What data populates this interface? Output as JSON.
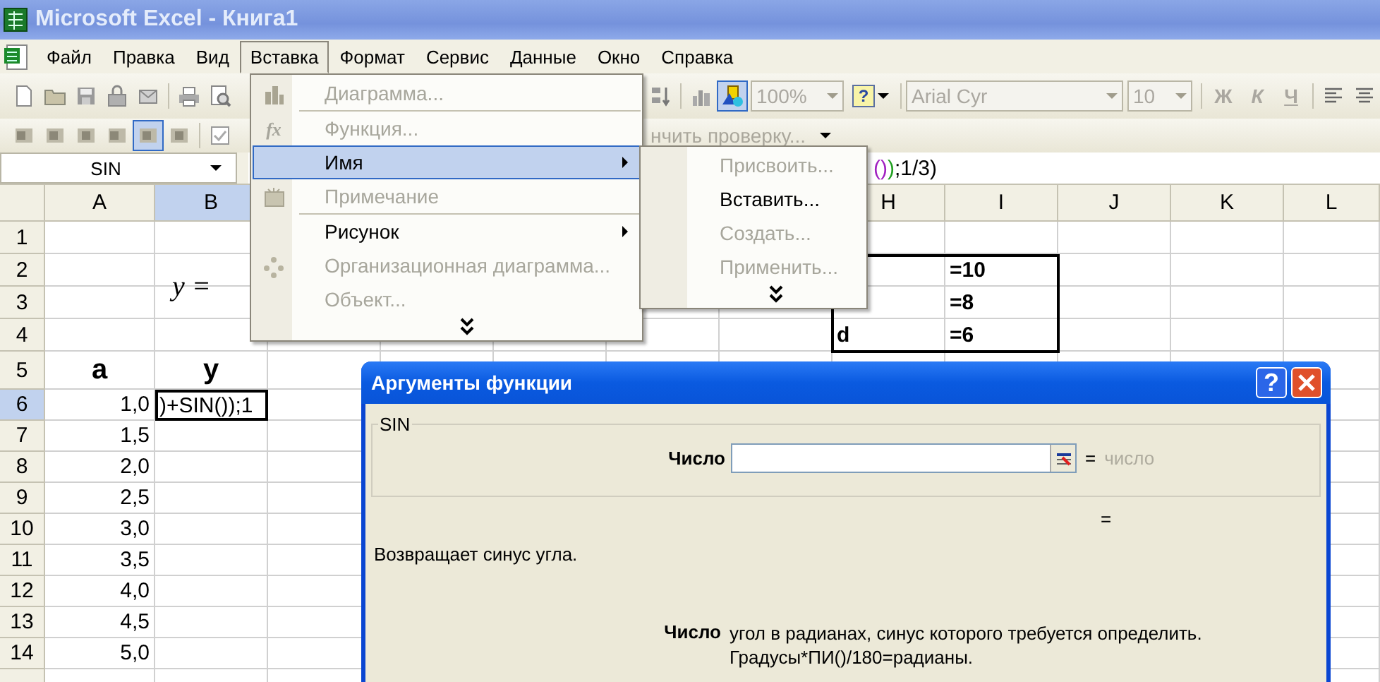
{
  "window": {
    "title": "Microsoft Excel - Книга1"
  },
  "menu_bar": [
    {
      "label": "Файл",
      "selected": false
    },
    {
      "label": "Правка",
      "selected": false
    },
    {
      "label": "Вид",
      "selected": false
    },
    {
      "label": "Вставка",
      "selected": true
    },
    {
      "label": "Формат",
      "selected": false
    },
    {
      "label": "Сервис",
      "selected": false
    },
    {
      "label": "Данные",
      "selected": false
    },
    {
      "label": "Окно",
      "selected": false
    },
    {
      "label": "Справка",
      "selected": false
    }
  ],
  "standard_toolbar": {
    "left_buttons": [
      {
        "pressed": false
      },
      {
        "pressed": false
      },
      {
        "pressed": false
      },
      {
        "pressed": false
      },
      {
        "pressed": false
      },
      {
        "pressed": false
      },
      {
        "pressed": false
      }
    ],
    "right_buttons": [
      {
        "pressed": false
      },
      {
        "pressed": false
      },
      {
        "pressed": true
      }
    ],
    "zoom": "100%",
    "help": "?",
    "font": "Arial Cyr",
    "font_size": "10",
    "format_buttons": [
      "Ж",
      "К",
      "Ч"
    ]
  },
  "review_toolbar": {
    "buttons": [
      {
        "pressed": false
      },
      {
        "pressed": false
      },
      {
        "pressed": false
      },
      {
        "pressed": false
      },
      {
        "pressed": true
      },
      {
        "pressed": false
      },
      {
        "pressed": false
      }
    ],
    "action": "нчить проверку..."
  },
  "formula_bar": {
    "name_box": "SIN",
    "formula": [
      {
        "text": "()",
        "color": "#a020c0"
      },
      {
        "text": ")",
        "color": "#20a020"
      },
      {
        "text": ";1/3)",
        "color": "#000000"
      }
    ]
  },
  "sheet": {
    "columns": [
      {
        "label": "A",
        "selected": false
      },
      {
        "label": "B",
        "selected": true
      },
      {
        "label": "H",
        "selected": false
      },
      {
        "label": "I",
        "selected": false
      },
      {
        "label": "J",
        "selected": false
      },
      {
        "label": "K",
        "selected": false
      },
      {
        "label": "L",
        "selected": false
      }
    ],
    "equation": "y =",
    "rows": [
      {
        "number": "1",
        "selected": false,
        "cells": {}
      },
      {
        "number": "2",
        "selected": false,
        "cells": {
          "I": {
            "text": "=10",
            "kind": "label"
          }
        }
      },
      {
        "number": "3",
        "selected": false,
        "cells": {
          "I": {
            "text": "=8",
            "kind": "label"
          }
        }
      },
      {
        "number": "4",
        "selected": false,
        "cells": {
          "H": {
            "text": "d",
            "kind": "label"
          },
          "I": {
            "text": "=6",
            "kind": "label"
          }
        }
      },
      {
        "number": "5",
        "selected": false,
        "cells": {
          "A": {
            "text": "a",
            "kind": "heading"
          },
          "B": {
            "text": "y",
            "kind": "heading"
          }
        }
      },
      {
        "number": "6",
        "selected": true,
        "cells": {
          "A": {
            "text": "1,0",
            "kind": "number"
          },
          "B": {
            "text": ")+SIN());1",
            "kind": "editing"
          }
        }
      },
      {
        "number": "7",
        "selected": false,
        "cells": {
          "A": {
            "text": "1,5",
            "kind": "number"
          }
        }
      },
      {
        "number": "8",
        "selected": false,
        "cells": {
          "A": {
            "text": "2,0",
            "kind": "number"
          }
        }
      },
      {
        "number": "9",
        "selected": false,
        "cells": {
          "A": {
            "text": "2,5",
            "kind": "number"
          }
        }
      },
      {
        "number": "10",
        "selected": false,
        "cells": {
          "A": {
            "text": "3,0",
            "kind": "number"
          }
        }
      },
      {
        "number": "11",
        "selected": false,
        "cells": {
          "A": {
            "text": "3,5",
            "kind": "number"
          }
        }
      },
      {
        "number": "12",
        "selected": false,
        "cells": {
          "A": {
            "text": "4,0",
            "kind": "number"
          }
        }
      },
      {
        "number": "13",
        "selected": false,
        "cells": {
          "A": {
            "text": "4,5",
            "kind": "number"
          }
        }
      },
      {
        "number": "14",
        "selected": false,
        "cells": {
          "A": {
            "text": "5,0",
            "kind": "number"
          }
        }
      }
    ]
  },
  "insert_menu": {
    "items": [
      {
        "kind": "item",
        "label": "Диаграмма...",
        "disabled": true,
        "selected": false,
        "submenu": false
      },
      {
        "kind": "separator"
      },
      {
        "kind": "item",
        "label": "Функция...",
        "glyph": "fx",
        "disabled": true,
        "selected": false,
        "submenu": false
      },
      {
        "kind": "item",
        "label": "Имя",
        "disabled": false,
        "selected": true,
        "submenu": true
      },
      {
        "kind": "item",
        "label": "Примечание",
        "disabled": true,
        "selected": false,
        "submenu": false
      },
      {
        "kind": "separator"
      },
      {
        "kind": "item",
        "label": "Рисунок",
        "disabled": false,
        "selected": false,
        "submenu": true
      },
      {
        "kind": "item",
        "label": "Организационная диаграмма...",
        "disabled": true,
        "selected": false,
        "submenu": false
      },
      {
        "kind": "item",
        "label": "Объект...",
        "disabled": true,
        "selected": false,
        "submenu": false
      },
      {
        "kind": "more"
      }
    ]
  },
  "name_submenu": {
    "items": [
      {
        "kind": "item",
        "label": "Присвоить...",
        "disabled": true,
        "selected": false
      },
      {
        "kind": "item",
        "label": "Вставить...",
        "disabled": false,
        "selected": false
      },
      {
        "kind": "item",
        "label": "Создать...",
        "disabled": true,
        "selected": false
      },
      {
        "kind": "item",
        "label": "Применить...",
        "disabled": true,
        "selected": false
      },
      {
        "kind": "more"
      }
    ]
  },
  "dialog": {
    "title": "Аргументы функции",
    "help": "?",
    "group": "SIN",
    "argument": {
      "label": "Число",
      "equals": "=",
      "result": "число"
    },
    "result_equals": "=",
    "description": "Возвращает синус угла.",
    "argument_help": {
      "label": "Число",
      "text": "угол в радианах, синус которого требуется определить.\nГрадусы*ПИ()/180=радианы."
    }
  }
}
